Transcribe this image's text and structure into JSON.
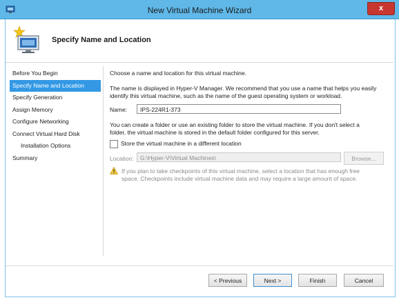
{
  "window": {
    "title": "New Virtual Machine Wizard",
    "close_glyph": "x"
  },
  "header": {
    "page_title": "Specify Name and Location"
  },
  "nav": {
    "items": [
      {
        "label": "Before You Begin"
      },
      {
        "label": "Specify Name and Location"
      },
      {
        "label": "Specify Generation"
      },
      {
        "label": "Assign Memory"
      },
      {
        "label": "Configure Networking"
      },
      {
        "label": "Connect Virtual Hard Disk"
      },
      {
        "label": "Installation Options"
      },
      {
        "label": "Summary"
      }
    ]
  },
  "main": {
    "intro": "Choose a name and location for this virtual machine.",
    "name_desc_1": "The name is displayed in Hyper-V Manager. We recommend that you use a name that helps you easily",
    "name_desc_2": "identify this virtual machine, such as the name of the guest operating system or workload.",
    "name_label": "Name:",
    "name_value": "IPS-224R1-373",
    "folder_desc_1": "You can create a folder or use an existing folder to store the virtual machine. If you don't select a",
    "folder_desc_2": "folder, the virtual machine is stored in the default folder configured for this server.",
    "store_checkbox_label": "Store the virtual machine in a different location",
    "location_label": "Location:",
    "location_value": "G:\\Hyper-V\\Virtual Machines\\",
    "browse_label": "Browse...",
    "warning_1": "If you plan to take checkpoints of this virtual machine, select a location that has enough free",
    "warning_2": "space. Checkpoints include virtual machine data and may require a large amount of space."
  },
  "footer": {
    "previous_label": "< Previous",
    "next_label": "Next >",
    "finish_label": "Finish",
    "cancel_label": "Cancel"
  },
  "colors": {
    "titlebar": "#5fb8e8",
    "selection": "#3399e5",
    "close": "#c7372f"
  }
}
